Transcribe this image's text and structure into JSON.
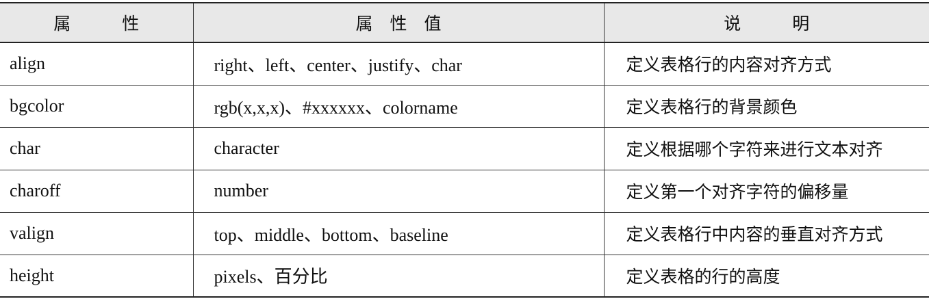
{
  "table": {
    "headers": [
      "属　　　性",
      "属　性　值",
      "说　　　明"
    ],
    "rows": [
      [
        "align",
        "right、left、center、justify、char",
        "定义表格行的内容对齐方式"
      ],
      [
        "bgcolor",
        "rgb(x,x,x)、#xxxxxx、colorname",
        "定义表格行的背景颜色"
      ],
      [
        "char",
        "character",
        "定义根据哪个字符来进行文本对齐"
      ],
      [
        "charoff",
        "number",
        "定义第一个对齐字符的偏移量"
      ],
      [
        "valign",
        "top、middle、bottom、baseline",
        "定义表格行中内容的垂直对齐方式"
      ],
      [
        "height",
        "pixels、百分比",
        "定义表格的行的高度"
      ]
    ]
  }
}
